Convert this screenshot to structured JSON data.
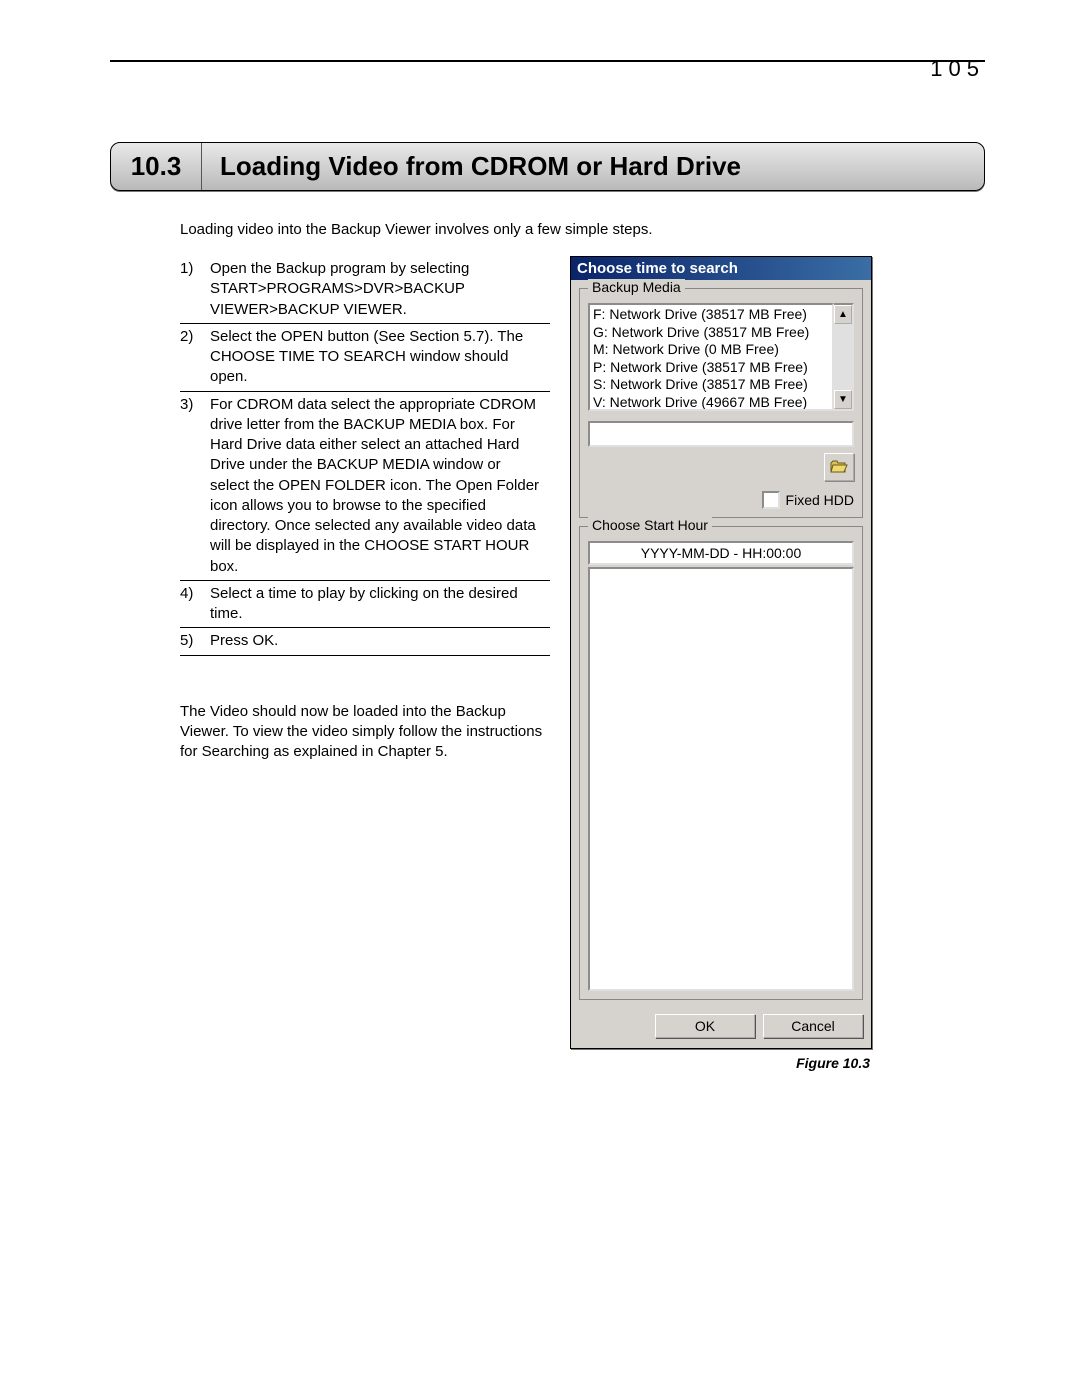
{
  "page_number": "105",
  "section": {
    "number": "10.3",
    "title": "Loading Video from CDROM or Hard Drive"
  },
  "intro_text": "Loading video into the Backup Viewer involves only a few simple steps.",
  "steps": [
    {
      "n": "1)",
      "text": "Open the Backup program by selecting START>PROGRAMS>DVR>BACKUP VIEWER>BACKUP VIEWER."
    },
    {
      "n": "2)",
      "text": "Select the OPEN button (See Section 5.7). The CHOOSE TIME TO SEARCH window should open."
    },
    {
      "n": "3)",
      "text": "For CDROM data select the appropriate CDROM drive letter from the BACKUP MEDIA box. For Hard Drive data either select an attached Hard Drive under the BACKUP MEDIA window or select the OPEN FOLDER icon. The Open Folder icon allows you to browse to the specified directory. Once selected any available video data will be displayed in the CHOOSE START HOUR box."
    },
    {
      "n": "4)",
      "text": "Select a time to play by clicking on the desired time."
    },
    {
      "n": "5)",
      "text": "Press OK."
    }
  ],
  "post_text": "The Video should now be loaded into the Backup Viewer. To view the video simply follow the instructions for Searching as explained in Chapter 5.",
  "dialog": {
    "title": "Choose time to search",
    "backup_media_legend": "Backup Media",
    "drives": [
      "F: Network Drive (38517 MB Free)",
      "G: Network Drive (38517 MB Free)",
      "M: Network Drive (0 MB Free)",
      "P: Network Drive (38517 MB Free)",
      "S: Network Drive (38517 MB Free)",
      "V: Network Drive (49667 MB Free)"
    ],
    "fixed_hdd_label": "Fixed HDD",
    "choose_start_hour_legend": "Choose Start Hour",
    "time_placeholder": "YYYY-MM-DD - HH:00:00",
    "ok_label": "OK",
    "cancel_label": "Cancel"
  },
  "figure_caption": "Figure 10.3"
}
